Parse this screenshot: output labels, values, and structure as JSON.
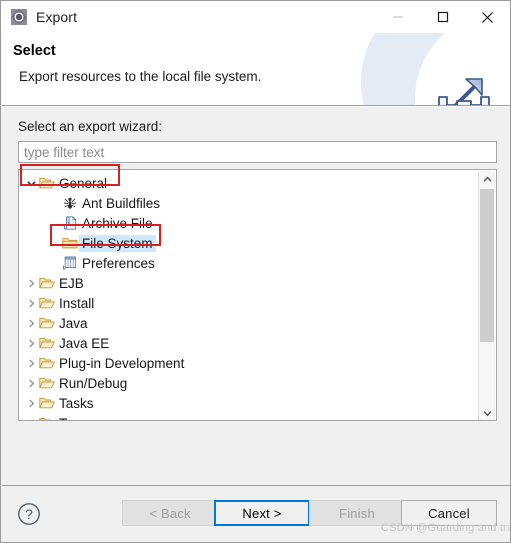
{
  "window": {
    "title": "Export",
    "icon": "export-wizard-icon",
    "controls": {
      "minimize": "minimize-icon",
      "maximize": "maximize-icon",
      "close": "close-icon"
    }
  },
  "header": {
    "title": "Select",
    "subtitle": "Export resources to the local file system.",
    "graphic": "export-tray-arrow-icon"
  },
  "main": {
    "wizard_label": "Select an export wizard:",
    "filter": {
      "value": "",
      "placeholder": "type filter text"
    },
    "tree": {
      "items": [
        {
          "label": "General",
          "icon": "folder-open-icon",
          "depth": 0,
          "expanded": true,
          "selected": false,
          "has_children": true,
          "annotated": true
        },
        {
          "label": "Ant Buildfiles",
          "icon": "ant-icon",
          "depth": 1,
          "expanded": false,
          "selected": false,
          "has_children": false,
          "annotated": false
        },
        {
          "label": "Archive File",
          "icon": "archive-file-icon",
          "depth": 1,
          "expanded": false,
          "selected": false,
          "has_children": false,
          "annotated": false
        },
        {
          "label": "File System",
          "icon": "folder-icon",
          "depth": 1,
          "expanded": false,
          "selected": true,
          "has_children": false,
          "annotated": true
        },
        {
          "label": "Preferences",
          "icon": "preferences-icon",
          "depth": 1,
          "expanded": false,
          "selected": false,
          "has_children": false,
          "annotated": false
        },
        {
          "label": "EJB",
          "icon": "folder-open-icon",
          "depth": 0,
          "expanded": false,
          "selected": false,
          "has_children": true,
          "annotated": false
        },
        {
          "label": "Install",
          "icon": "folder-open-icon",
          "depth": 0,
          "expanded": false,
          "selected": false,
          "has_children": true,
          "annotated": false
        },
        {
          "label": "Java",
          "icon": "folder-open-icon",
          "depth": 0,
          "expanded": false,
          "selected": false,
          "has_children": true,
          "annotated": false
        },
        {
          "label": "Java EE",
          "icon": "folder-open-icon",
          "depth": 0,
          "expanded": false,
          "selected": false,
          "has_children": true,
          "annotated": false
        },
        {
          "label": "Plug-in Development",
          "icon": "folder-open-icon",
          "depth": 0,
          "expanded": false,
          "selected": false,
          "has_children": true,
          "annotated": false
        },
        {
          "label": "Run/Debug",
          "icon": "folder-open-icon",
          "depth": 0,
          "expanded": false,
          "selected": false,
          "has_children": true,
          "annotated": false
        },
        {
          "label": "Tasks",
          "icon": "folder-open-icon",
          "depth": 0,
          "expanded": false,
          "selected": false,
          "has_children": true,
          "annotated": false
        },
        {
          "label": "T",
          "icon": "folder-open-icon",
          "depth": 0,
          "expanded": false,
          "selected": false,
          "has_children": true,
          "annotated": false
        }
      ],
      "scrollbar": {
        "up": "chevron-up-icon",
        "down": "chevron-down-icon"
      }
    }
  },
  "footer": {
    "help": "help-icon",
    "buttons": [
      {
        "label": "< Back",
        "state": "disabled"
      },
      {
        "label": "Next >",
        "state": "focused"
      },
      {
        "label": "Finish",
        "state": "disabled"
      },
      {
        "label": "Cancel",
        "state": "normal"
      }
    ]
  },
  "watermark": "CSDN @Guarding and trust",
  "colors": {
    "accent": "#0078d7",
    "annotation": "#d32020",
    "selection": "#cde8ff",
    "folder": "#e8b960",
    "dialog_bg": "#f0f0f0"
  }
}
